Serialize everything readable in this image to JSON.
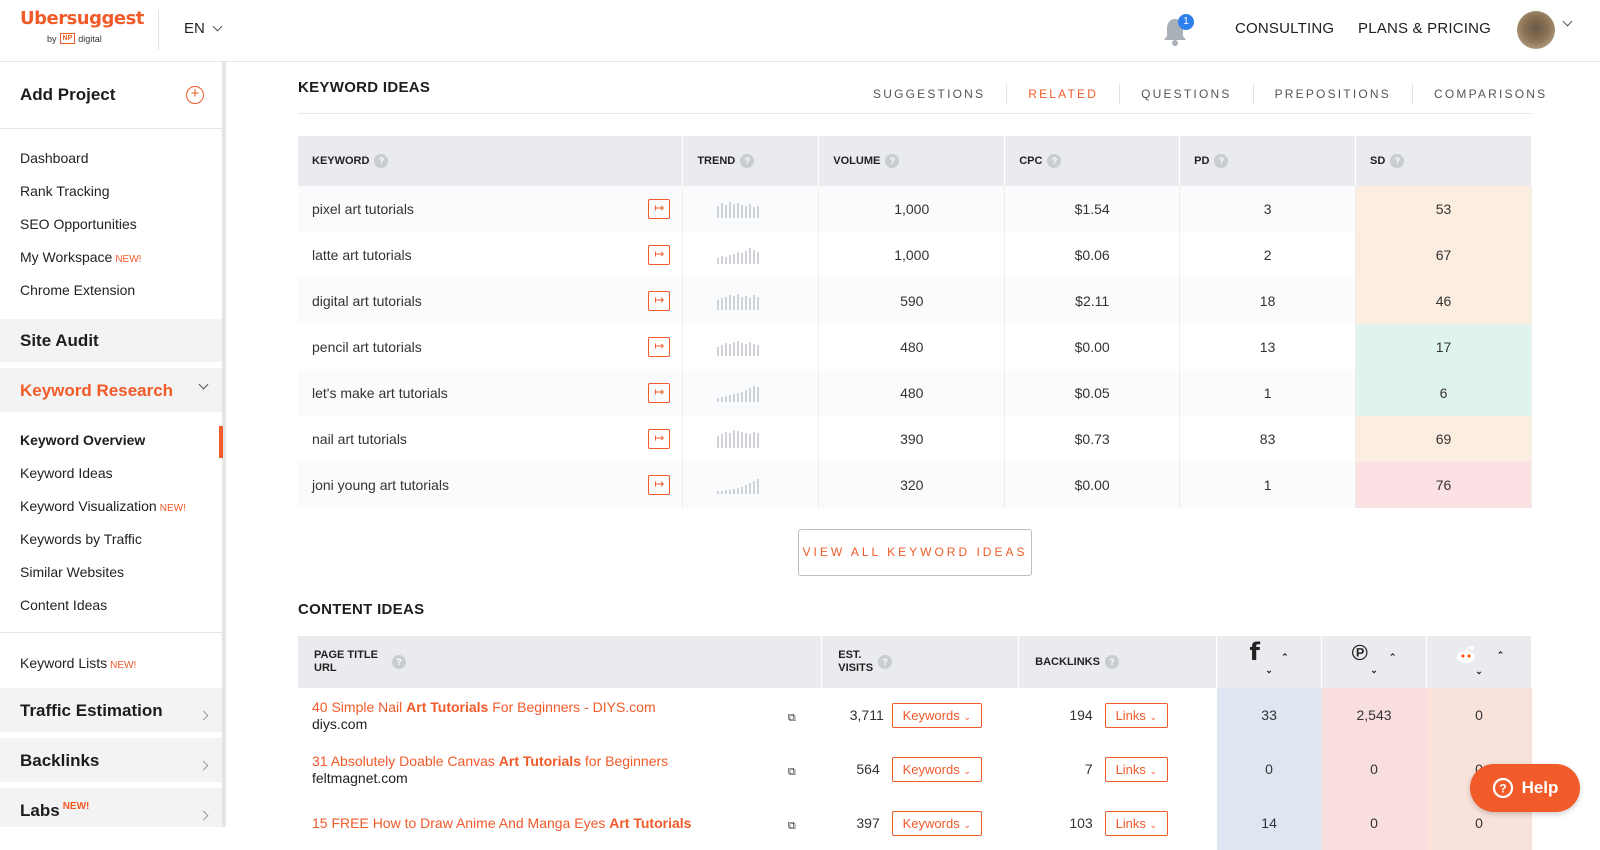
{
  "header": {
    "logo": "Ubersuggest",
    "logo_by": "by",
    "logo_np": "NP",
    "logo_digital": "digital",
    "lang": "EN",
    "notifications": "1",
    "consulting": "CONSULTING",
    "plans": "PLANS & PRICING"
  },
  "sidebar": {
    "add_project": "Add Project",
    "top_items": [
      "Dashboard",
      "Rank Tracking",
      "SEO Opportunities",
      "My Workspace",
      "Chrome Extension"
    ],
    "new_badge": "NEW!",
    "site_audit": "Site Audit",
    "keyword_research": "Keyword Research",
    "kr_items": [
      "Keyword Overview",
      "Keyword Ideas",
      "Keyword Visualization",
      "Keywords by Traffic",
      "Similar Websites",
      "Content Ideas"
    ],
    "keyword_lists": "Keyword Lists",
    "traffic_estimation": "Traffic Estimation",
    "backlinks": "Backlinks",
    "labs": "Labs"
  },
  "keyword_ideas": {
    "title": "KEYWORD IDEAS",
    "tabs": [
      "SUGGESTIONS",
      "RELATED",
      "QUESTIONS",
      "PREPOSITIONS",
      "COMPARISONS"
    ],
    "active_tab": "RELATED",
    "columns": [
      "KEYWORD",
      "TREND",
      "VOLUME",
      "CPC",
      "PD",
      "SD"
    ],
    "rows": [
      {
        "keyword": "pixel art tutorials",
        "volume": "1,000",
        "cpc": "$1.54",
        "pd": "3",
        "sd": "53",
        "sd_color": "#fbeee0"
      },
      {
        "keyword": "latte art tutorials",
        "volume": "1,000",
        "cpc": "$0.06",
        "pd": "2",
        "sd": "67",
        "sd_color": "#fbeee0"
      },
      {
        "keyword": "digital art tutorials",
        "volume": "590",
        "cpc": "$2.11",
        "pd": "18",
        "sd": "46",
        "sd_color": "#fbeee0"
      },
      {
        "keyword": "pencil art tutorials",
        "volume": "480",
        "cpc": "$0.00",
        "pd": "13",
        "sd": "17",
        "sd_color": "#dff5ec"
      },
      {
        "keyword": "let's make art tutorials",
        "volume": "480",
        "cpc": "$0.05",
        "pd": "1",
        "sd": "6",
        "sd_color": "#dff5ec"
      },
      {
        "keyword": "nail art tutorials",
        "volume": "390",
        "cpc": "$0.73",
        "pd": "83",
        "sd": "69",
        "sd_color": "#fbeee0"
      },
      {
        "keyword": "joni young art tutorials",
        "volume": "320",
        "cpc": "$0.00",
        "pd": "1",
        "sd": "76",
        "sd_color": "#fbe1e3"
      }
    ],
    "view_all": "VIEW ALL KEYWORD IDEAS"
  },
  "content_ideas": {
    "title": "CONTENT IDEAS",
    "col_page_title": "PAGE TITLE",
    "col_url": "URL",
    "col_visits_1": "EST.",
    "col_visits_2": "VISITS",
    "col_backlinks": "BACKLINKS",
    "keywords_btn": "Keywords",
    "links_btn": "Links",
    "rows": [
      {
        "title_pre": "40 Simple Nail ",
        "title_bold": "Art Tutorials",
        "title_post": " For Beginners - DIYS.com",
        "url": "diys.com",
        "visits": "3,711",
        "backlinks": "194",
        "fb": "33",
        "pin": "2,543",
        "reddit": "0"
      },
      {
        "title_pre": "31 Absolutely Doable Canvas ",
        "title_bold": "Art Tutorials",
        "title_post": " for Beginners",
        "url": "feltmagnet.com",
        "visits": "564",
        "backlinks": "7",
        "fb": "0",
        "pin": "0",
        "reddit": "0"
      },
      {
        "title_pre": "15 FREE How to Draw Anime And Manga Eyes ",
        "title_bold": "Art Tutorials",
        "title_post": "",
        "url": "",
        "visits": "397",
        "backlinks": "103",
        "fb": "14",
        "pin": "0",
        "reddit": "0"
      }
    ]
  },
  "help": "Help",
  "colors": {
    "accent": "#f15a29",
    "facebook": "#3b5998",
    "pinterest": "#e12828",
    "reddit": "#ff4500"
  }
}
